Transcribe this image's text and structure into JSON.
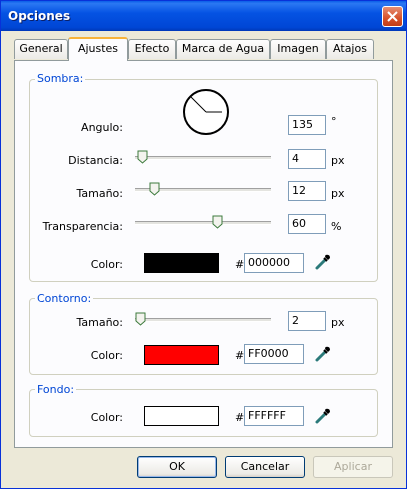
{
  "window": {
    "title": "Opciones"
  },
  "tabs": [
    "General",
    "Ajustes",
    "Efecto",
    "Marca de Agua",
    "Imagen",
    "Atajos"
  ],
  "active_tab": "Ajustes",
  "sombra": {
    "legend": "Sombra:",
    "angulo": {
      "label": "Angulo:",
      "value": "135",
      "unit": "°"
    },
    "distancia": {
      "label": "Distancia:",
      "value": "4",
      "unit": "px",
      "slider_fraction": 0.04
    },
    "tamano": {
      "label": "Tamaño:",
      "value": "12",
      "unit": "px",
      "slider_fraction": 0.12
    },
    "transparencia": {
      "label": "Transparencia:",
      "value": "60",
      "unit": "%",
      "slider_fraction": 0.6
    },
    "color": {
      "label": "Color:",
      "hash": "#",
      "hex": "000000",
      "swatch": "#000000"
    }
  },
  "contorno": {
    "legend": "Contorno:",
    "tamano": {
      "label": "Tamaño:",
      "value": "2",
      "unit": "px",
      "slider_fraction": 0.0
    },
    "color": {
      "label": "Color:",
      "hash": "#",
      "hex": "FF0000",
      "swatch": "#ff0000"
    }
  },
  "fondo": {
    "legend": "Fondo:",
    "color": {
      "label": "Color:",
      "hash": "#",
      "hex": "FFFFFF",
      "swatch": "#ffffff"
    }
  },
  "buttons": {
    "ok": "OK",
    "cancel": "Cancelar",
    "apply": "Aplicar"
  },
  "icons": {
    "close": "close-icon",
    "angle_dial": "angle-dial-icon",
    "eyedropper": "eyedropper-icon"
  }
}
